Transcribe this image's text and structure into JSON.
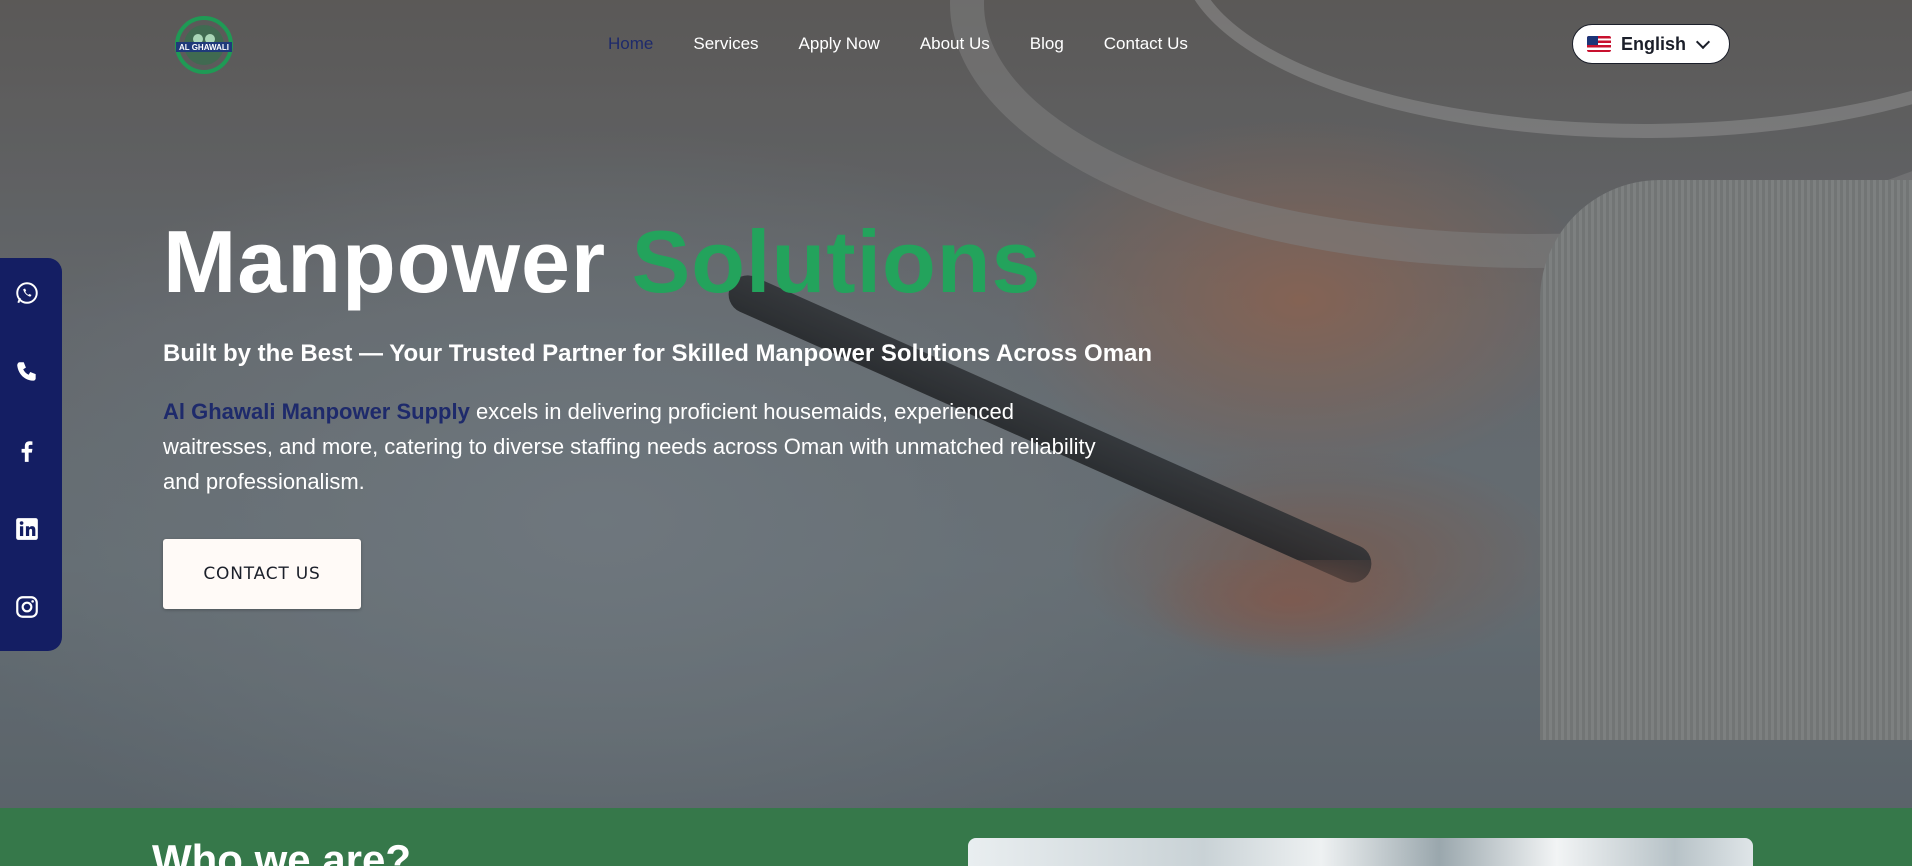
{
  "header": {
    "logo_text": "AL GHAWALI",
    "nav": [
      {
        "label": "Home",
        "active": true
      },
      {
        "label": "Services",
        "active": false
      },
      {
        "label": "Apply Now",
        "active": false
      },
      {
        "label": "About Us",
        "active": false
      },
      {
        "label": "Blog",
        "active": false
      },
      {
        "label": "Contact Us",
        "active": false
      }
    ],
    "language": {
      "label": "English",
      "flag": "us-flag-icon"
    }
  },
  "social": [
    {
      "icon": "whatsapp-icon"
    },
    {
      "icon": "phone-icon"
    },
    {
      "icon": "facebook-icon"
    },
    {
      "icon": "linkedin-icon"
    },
    {
      "icon": "instagram-icon"
    }
  ],
  "hero": {
    "title_part1": "Manpower",
    "title_part2": "Solutions",
    "subtitle": "Built by the Best — Your Trusted Partner for Skilled Manpower Solutions Across Oman",
    "description_brand": "Al Ghawali Manpower Supply",
    "description_rest": " excels in delivering proficient housemaids, experienced waitresses, and more, catering to diverse staffing needs across Oman with unmatched reliability and professionalism.",
    "cta_label": "CONTACT US"
  },
  "who": {
    "heading": "Who we are?"
  },
  "colors": {
    "brand_green": "#23a35c",
    "navy": "#141e63",
    "strip_green": "#36784a"
  }
}
